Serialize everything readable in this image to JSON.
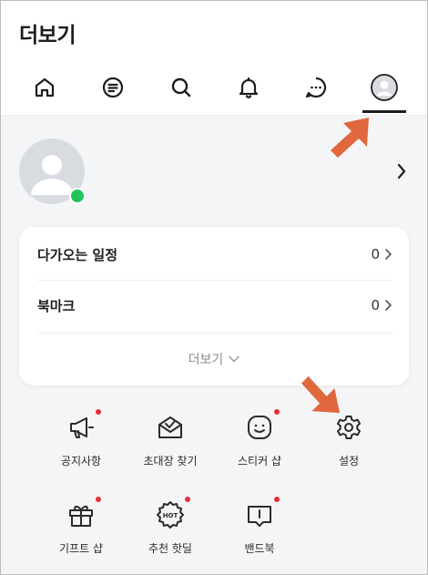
{
  "header": {
    "title": "더보기"
  },
  "nav": {
    "tabs": [
      {
        "name": "home",
        "icon": "home-icon"
      },
      {
        "name": "feed",
        "icon": "feed-icon"
      },
      {
        "name": "search",
        "icon": "search-icon"
      },
      {
        "name": "notifications",
        "icon": "bell-icon"
      },
      {
        "name": "chat",
        "icon": "chat-icon"
      },
      {
        "name": "more",
        "icon": "profile-icon",
        "selected": true
      }
    ]
  },
  "profile": {
    "status": "online",
    "status_color": "#22c45a"
  },
  "card": {
    "rows": [
      {
        "label": "다가오는 일정",
        "count": "0"
      },
      {
        "label": "북마크",
        "count": "0"
      }
    ],
    "more_label": "더보기"
  },
  "menu": {
    "items": [
      {
        "label": "공지사항",
        "icon": "megaphone-icon",
        "badge": true
      },
      {
        "label": "초대장 찾기",
        "icon": "envelope-icon",
        "badge": false
      },
      {
        "label": "스티커 샵",
        "icon": "sticker-icon",
        "badge": true
      },
      {
        "label": "설정",
        "icon": "gear-icon",
        "badge": false
      },
      {
        "label": "기프트 샵",
        "icon": "gift-icon",
        "badge": true
      },
      {
        "label": "추천 핫딜",
        "icon": "hot-badge-icon",
        "badge": true
      },
      {
        "label": "밴드북",
        "icon": "book-icon",
        "badge": true
      }
    ]
  },
  "annotation_color": "#e0673e"
}
